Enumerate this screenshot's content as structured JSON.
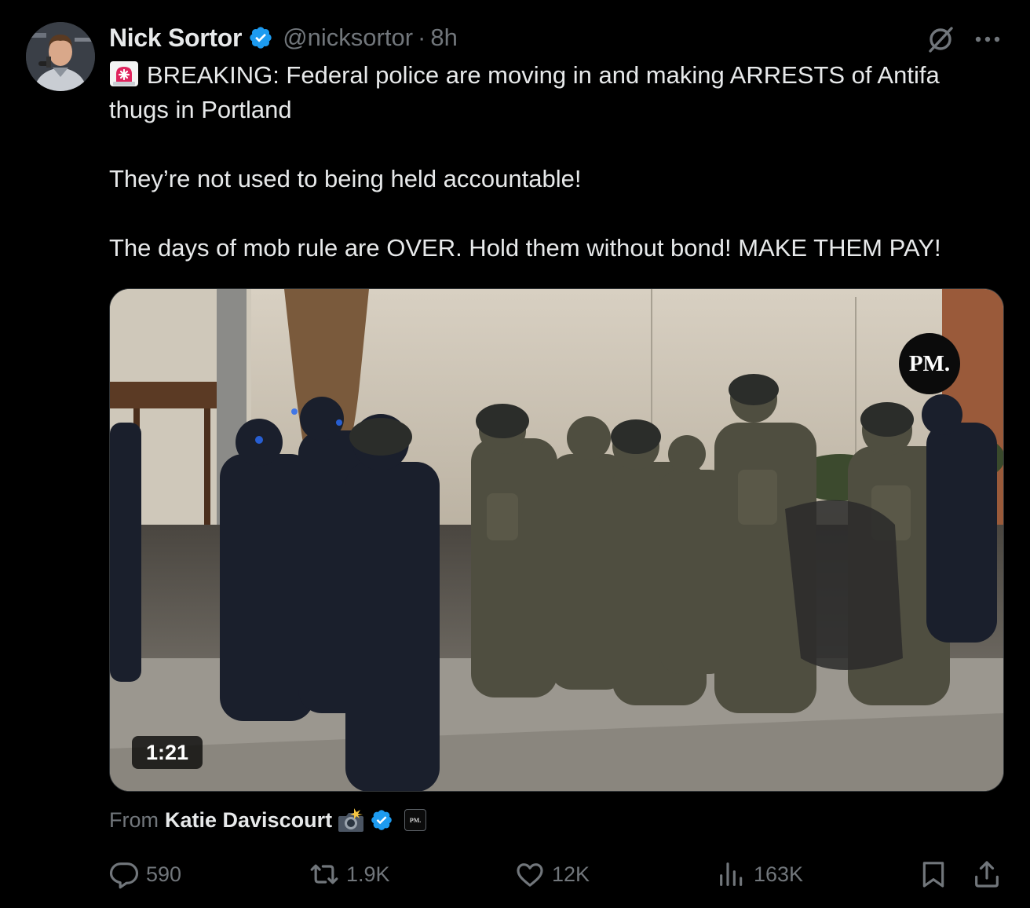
{
  "author": {
    "display_name": "Nick Sortor",
    "handle": "@nicksortor",
    "separator": "·",
    "time": "8h",
    "verified": true
  },
  "header_icons": [
    "grok-icon",
    "more-icon"
  ],
  "tweet": {
    "siren_emoji": "🚨",
    "line1": "BREAKING: Federal police are moving in and making ARRESTS of Antifa thugs in Portland",
    "line2": "They’re not used to being held accountable!",
    "line3": "The days of mob rule are OVER. Hold them without bond! MAKE THEM PAY!"
  },
  "media": {
    "type": "video",
    "duration": "1:21",
    "watermark": "PM."
  },
  "attribution": {
    "label": "From",
    "name": "Katie Daviscourt",
    "emoji": "📸",
    "verified": true,
    "affiliate_badge": "PM."
  },
  "actions": {
    "replies": "590",
    "reposts": "1.9K",
    "likes": "12K",
    "views": "163K"
  },
  "colors": {
    "background": "#000000",
    "text_primary": "#e7e9ea",
    "text_secondary": "#71767b",
    "verified_blue": "#1d9bf0",
    "siren_red": "#e0245e"
  }
}
